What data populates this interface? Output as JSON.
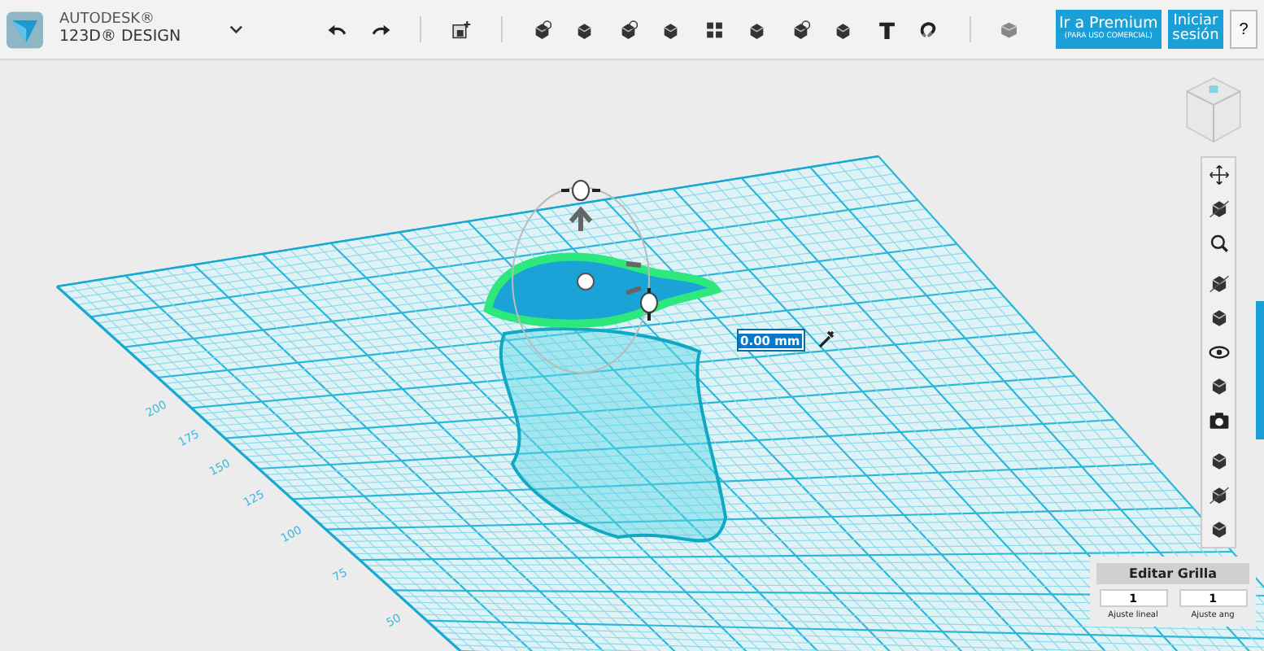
{
  "app": {
    "brand_line1": "AUTODESK®",
    "brand_line2": "123D® DESIGN"
  },
  "premium_button": {
    "label": "Ir a Premium",
    "sublabel": "(PARA USO COMERCIAL)"
  },
  "signin_button": {
    "label": "Iniciar sesión"
  },
  "help_button": {
    "label": "?"
  },
  "viewport": {
    "grid_labels": [
      "200",
      "175",
      "150",
      "125",
      "100",
      "75",
      "50"
    ],
    "distance_input": {
      "value": "0.00 mm"
    }
  },
  "grid_panel": {
    "title": "Editar Grilla",
    "fields": [
      {
        "value": "1",
        "label": "Ajuste lineal"
      },
      {
        "value": "1",
        "label": "Ajuste ang"
      }
    ]
  }
}
